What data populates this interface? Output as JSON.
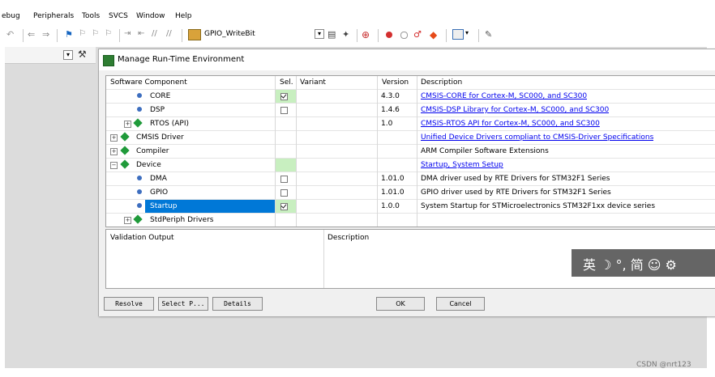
{
  "menu": [
    "ebug",
    "Peripherals",
    "Tools",
    "SVCS",
    "Window",
    "Help"
  ],
  "toolbar": {
    "target_name": "GPIO_WriteBit"
  },
  "dialog": {
    "title": "Manage Run-Time Environment",
    "columns": [
      "Software Component",
      "Sel.",
      "Variant",
      "Version",
      "Description"
    ],
    "rows": [
      {
        "name": "CORE",
        "sel": "checked",
        "variant": "",
        "version": "4.3.0",
        "desc": "CMSIS-CORE for Cortex-M, SC000, and SC300",
        "link": true
      },
      {
        "name": "DSP",
        "sel": "unchecked",
        "variant": "",
        "version": "1.4.6",
        "desc": "CMSIS-DSP Library for Cortex-M, SC000, and SC300",
        "link": true
      },
      {
        "name": "RTOS (API)",
        "sel": "",
        "variant": "",
        "version": "1.0",
        "desc": "CMSIS-RTOS API for Cortex-M, SC000, and SC300",
        "link": true
      },
      {
        "name": "CMSIS Driver",
        "sel": "",
        "variant": "",
        "version": "",
        "desc": "Unified Device Drivers compliant to CMSIS-Driver Specifications",
        "link": true
      },
      {
        "name": "Compiler",
        "sel": "",
        "variant": "",
        "version": "",
        "desc": "ARM Compiler Software Extensions",
        "link": false
      },
      {
        "name": "Device",
        "sel": "",
        "variant": "",
        "version": "",
        "desc": "Startup, System Setup",
        "link": true
      },
      {
        "name": "DMA",
        "sel": "unchecked",
        "variant": "",
        "version": "1.01.0",
        "desc": "DMA driver used by RTE Drivers for STM32F1 Series",
        "link": false
      },
      {
        "name": "GPIO",
        "sel": "unchecked",
        "variant": "",
        "version": "1.01.0",
        "desc": "GPIO driver used by RTE Drivers for STM32F1 Series",
        "link": false
      },
      {
        "name": "Startup",
        "sel": "checked",
        "variant": "",
        "version": "1.0.0",
        "desc": "System Startup for STMicroelectronics STM32F1xx device series",
        "link": false
      },
      {
        "name": "StdPeriph Drivers",
        "sel": "",
        "variant": "",
        "version": "",
        "desc": "",
        "link": false
      }
    ],
    "validation_label": "Validation Output",
    "description_label": "Description",
    "buttons": {
      "resolve": "Resolve",
      "select": "Select P...",
      "details": "Details",
      "ok": "OK",
      "cancel": "Cancel"
    }
  },
  "ime_bar": "英 ☽ °, 简 ☺ ⚙",
  "watermark": "CSDN @nrt123"
}
